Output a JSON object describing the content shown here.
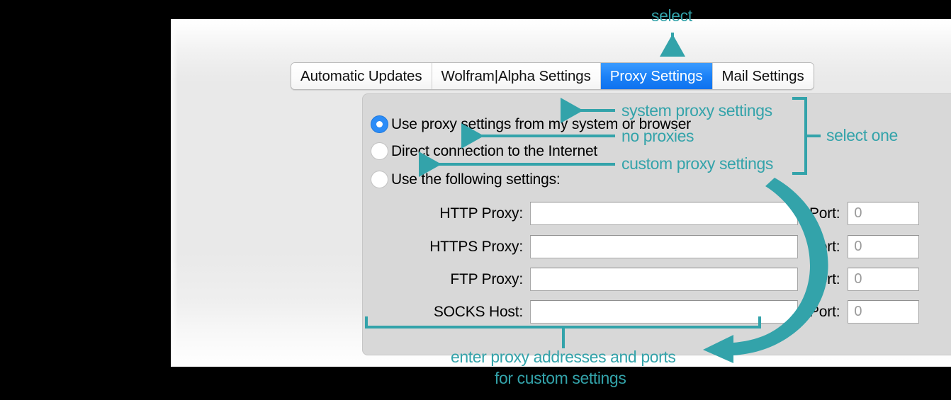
{
  "window": {
    "tabs": [
      {
        "label": "Automatic Updates",
        "active": false
      },
      {
        "label": "Wolfram|Alpha Settings",
        "active": false
      },
      {
        "label": "Proxy Settings",
        "active": true
      },
      {
        "label": "Mail Settings",
        "active": false
      }
    ],
    "proxy_options": [
      {
        "label": "Use proxy settings from my system or browser",
        "selected": true
      },
      {
        "label": "Direct connection to the Internet",
        "selected": false
      },
      {
        "label": "Use the following settings:",
        "selected": false
      }
    ],
    "fields": [
      {
        "label": "HTTP Proxy:",
        "value": "",
        "port_label": "Port:",
        "port_value": "0"
      },
      {
        "label": "HTTPS Proxy:",
        "value": "",
        "port_label": "Port:",
        "port_value": "0"
      },
      {
        "label": "FTP Proxy:",
        "value": "",
        "port_label": "Port:",
        "port_value": "0"
      },
      {
        "label": "SOCKS Host:",
        "value": "",
        "port_label": "Port:",
        "port_value": "0"
      }
    ]
  },
  "annotations": {
    "select_tab": "select",
    "option_1": "system proxy settings",
    "option_2": "no proxies",
    "option_3": "custom proxy settings",
    "select_one": "select one",
    "fields_line_1": "enter proxy addresses and ports",
    "fields_line_2": "for custom settings"
  },
  "colors": {
    "annotation_teal": "#33a3aa",
    "active_tab_blue": "#1a80f6",
    "radio_selected_blue": "#2b8cf7",
    "panel_gray": "#d8d8d8"
  }
}
